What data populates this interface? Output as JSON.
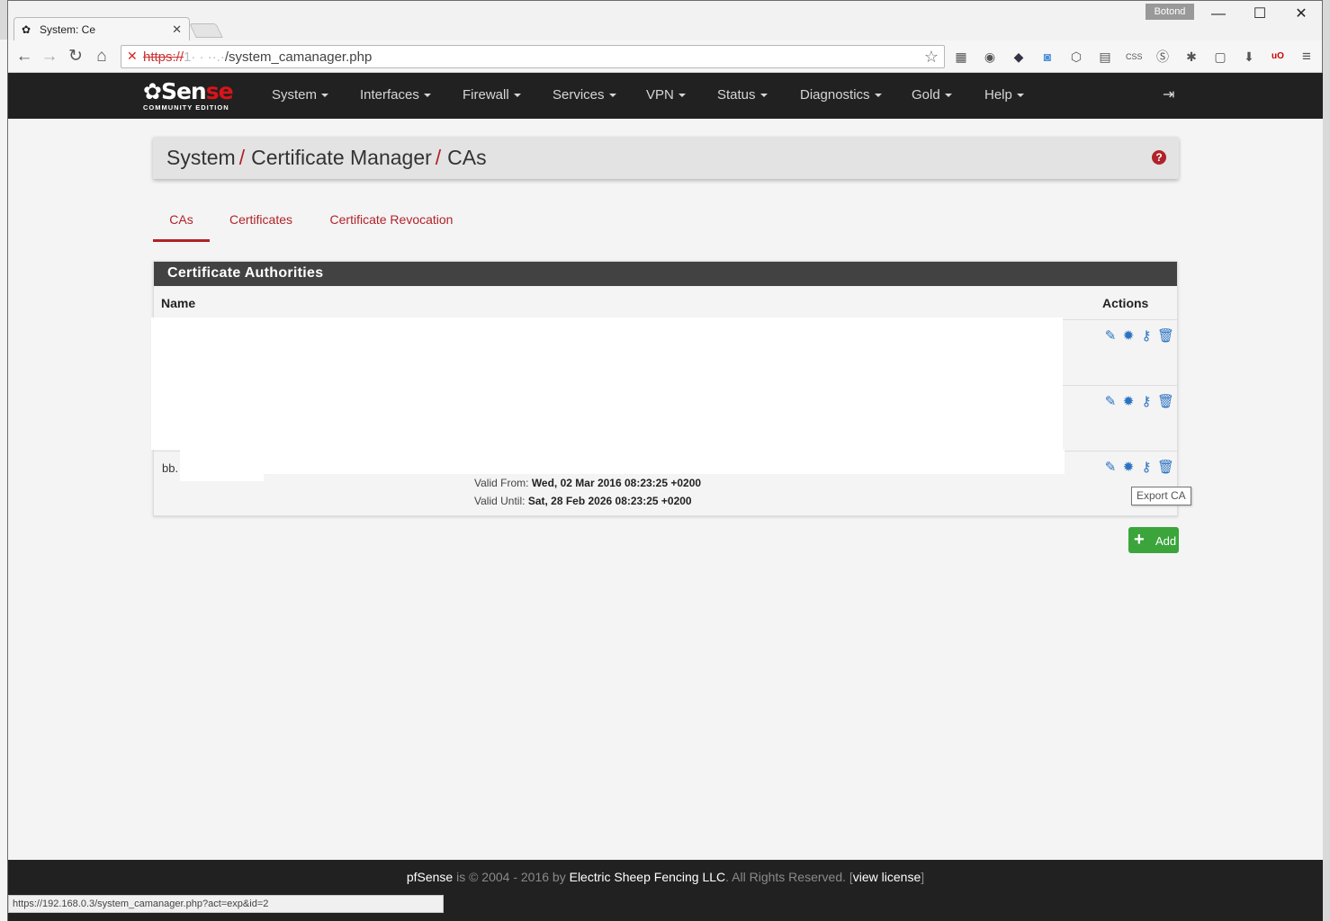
{
  "browser": {
    "tab_title": "System: Ce",
    "profile_name": "Botond",
    "url_protocol": "https://",
    "url_host": "1· ·  ··.·",
    "url_path": "/system_camanager.php",
    "status_url": "https://192.168.0.3/system_camanager.php?act=exp&id=2"
  },
  "nav": {
    "logo_text_a": "Sen",
    "logo_text_b": "se",
    "logo_sub": "COMMUNITY EDITION",
    "items": [
      {
        "label": "System"
      },
      {
        "label": "Interfaces"
      },
      {
        "label": "Firewall"
      },
      {
        "label": "Services"
      },
      {
        "label": "VPN"
      },
      {
        "label": "Status"
      },
      {
        "label": "Diagnostics"
      },
      {
        "label": "Gold"
      },
      {
        "label": "Help"
      }
    ]
  },
  "breadcrumb": {
    "parts": [
      "System",
      "Certificate Manager",
      "CAs"
    ],
    "separator": "/"
  },
  "tabs": [
    {
      "label": "CAs",
      "active": true
    },
    {
      "label": "Certificates",
      "active": false
    },
    {
      "label": "Certificate Revocation",
      "active": false
    }
  ],
  "panel": {
    "title": "Certificate Authorities",
    "col_name": "Name",
    "col_actions": "Actions",
    "rows": [
      {
        "name": ""
      },
      {
        "name": ""
      },
      {
        "name": "bb.",
        "valid_from_label": "Valid From:",
        "valid_from": "Wed, 02 Mar 2016 08:23:25 +0200",
        "valid_until_label": "Valid Until:",
        "valid_until": "Sat, 28 Feb 2026 08:23:25 +0200"
      }
    ]
  },
  "tooltip": "Export CA",
  "add_button": "Add",
  "footer": {
    "product": "pfSense",
    "is": "is © 2004 - 2016 by",
    "company": "Electric Sheep Fencing LLC",
    "rights": ". All Rights Reserved. [",
    "license": "view license",
    "close": "]"
  },
  "colors": {
    "accent_red": "#b0232a",
    "navbar": "#212121",
    "action_blue": "#2b72c2",
    "add_green": "#3ba53b"
  },
  "icons": [
    "back-icon",
    "forward-icon",
    "reload-icon",
    "home-icon",
    "bookmark-star-icon",
    "logout-icon",
    "help-icon",
    "edit-icon",
    "export-icon",
    "key-icon",
    "trash-icon",
    "plus-icon"
  ]
}
